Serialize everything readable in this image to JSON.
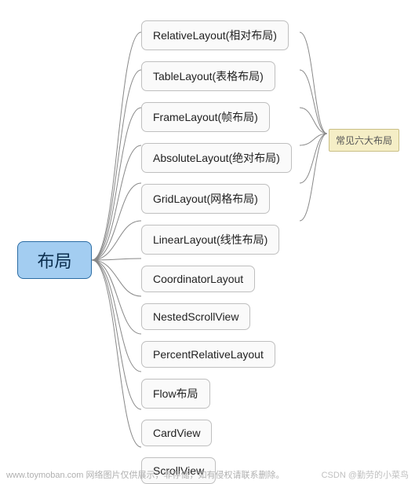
{
  "root": {
    "label": "布局"
  },
  "children": [
    {
      "label": "RelativeLayout(相对布局)"
    },
    {
      "label": "TableLayout(表格布局)"
    },
    {
      "label": "FrameLayout(帧布局)"
    },
    {
      "label": "AbsoluteLayout(绝对布局)"
    },
    {
      "label": "GridLayout(网格布局)"
    },
    {
      "label": "LinearLayout(线性布局)"
    },
    {
      "label": "CoordinatorLayout"
    },
    {
      "label": "NestedScrollView"
    },
    {
      "label": "PercentRelativeLayout"
    },
    {
      "label": "Flow布局"
    },
    {
      "label": "CardView"
    },
    {
      "label": "ScrollView"
    }
  ],
  "group": {
    "label": "常见六大布局"
  },
  "footer": {
    "left": "www.toymoban.com 网络图片仅供展示，非存储，如有侵权请联系删除。",
    "right": "CSDN @勤劳的小菜鸟"
  },
  "colors": {
    "root_bg": "#a3cdf1",
    "root_border": "#2b6ca3",
    "child_border": "#bfbfbf",
    "group_bg": "#f5eec6",
    "connector": "#888888"
  }
}
